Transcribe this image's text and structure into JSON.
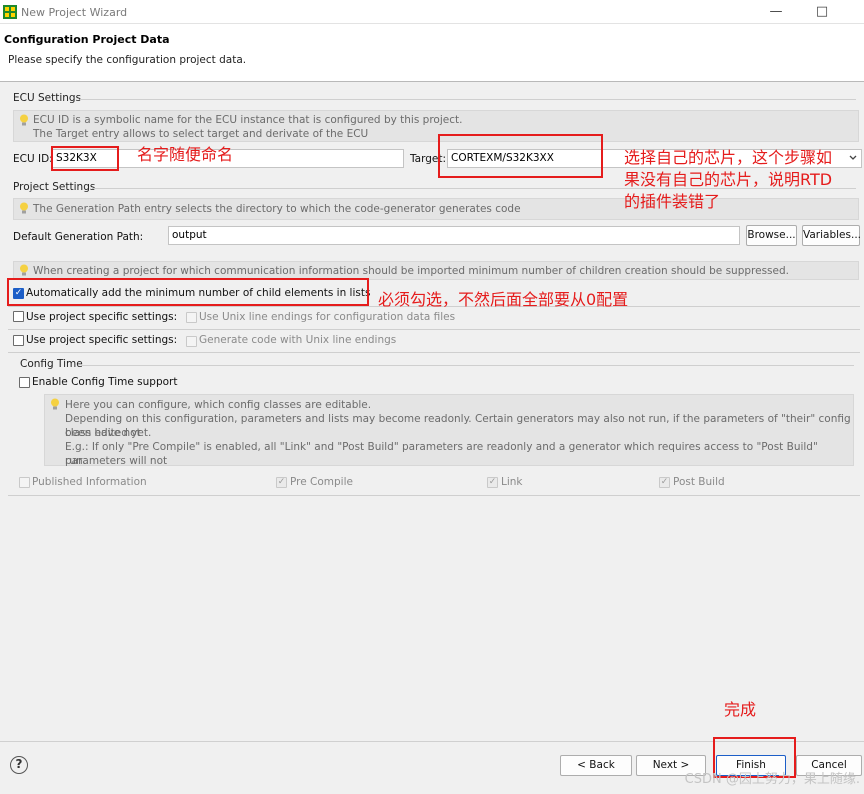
{
  "window": {
    "title": "New Project Wizard",
    "minimize_glyph": "—",
    "maximize_glyph": "□"
  },
  "header": {
    "title": "Configuration Project Data",
    "subtitle": "Please specify the configuration project data."
  },
  "ecu_settings": {
    "label": "ECU Settings",
    "info_line1": "ECU ID is a symbolic name for the ECU instance that is configured by this project.",
    "info_line2": "The Target entry allows to select target and derivate of the ECU",
    "ecu_id_label": "ECU ID:",
    "ecu_id_value": "S32K3X",
    "target_label": "Target:",
    "target_value": "CORTEXM/S32K3XX"
  },
  "project_settings": {
    "label": "Project Settings",
    "info": "The Generation Path entry selects the directory to which the code-generator generates code",
    "gen_path_label": "Default Generation Path:",
    "gen_path_value": "output",
    "browse_label": "Browse...",
    "variables_label": "Variables...",
    "comm_info": "When creating a project for which communication information should be imported minimum number of children creation should be suppressed.",
    "auto_add_label": "Automatically add the minimum number of child elements in lists",
    "auto_add_checked": true,
    "use_specific_1": "Use project specific settings:",
    "unix_endings_config": "Use Unix line endings for configuration data files",
    "use_specific_2": "Use project specific settings:",
    "unix_endings_code": "Generate code with Unix line endings"
  },
  "config_time": {
    "label": "Config Time",
    "enable_label": "Enable Config Time support",
    "info_line1": "Here you can configure, which config classes are editable.",
    "info_line2": "Depending on this configuration, parameters and lists may become readonly. Certain generators may also not run, if the parameters of \"their\" config class have not",
    "info_line3": "been edited yet.",
    "info_line4": "E.g.: If only \"Pre Compile\" is enabled, all \"Link\" and \"Post Build\" parameters are readonly and a generator which requires access to \"Post Build\" parameters will not",
    "info_line5": "run.",
    "published_info": "Published Information",
    "pre_compile": "Pre Compile",
    "link": "Link",
    "post_build": "Post Build"
  },
  "annotations": {
    "name_note": "名字随便命名",
    "target_note_1": "选择自己的芯片，这个步骤如",
    "target_note_2": "果没有自己的芯片，说明RTD",
    "target_note_3": "的插件装错了",
    "check_note": "必须勾选，不然后面全部要从0配置",
    "finish_note": "完成"
  },
  "footer": {
    "help_glyph": "?",
    "back_label": "< Back",
    "next_label": "Next >",
    "finish_label": "Finish",
    "cancel_label": "Cancel",
    "watermark": "CSDN @因上努力，果上随缘."
  },
  "colors": {
    "annotation_red": "#e51c1c",
    "checkbox_blue": "#1c5ec7"
  }
}
